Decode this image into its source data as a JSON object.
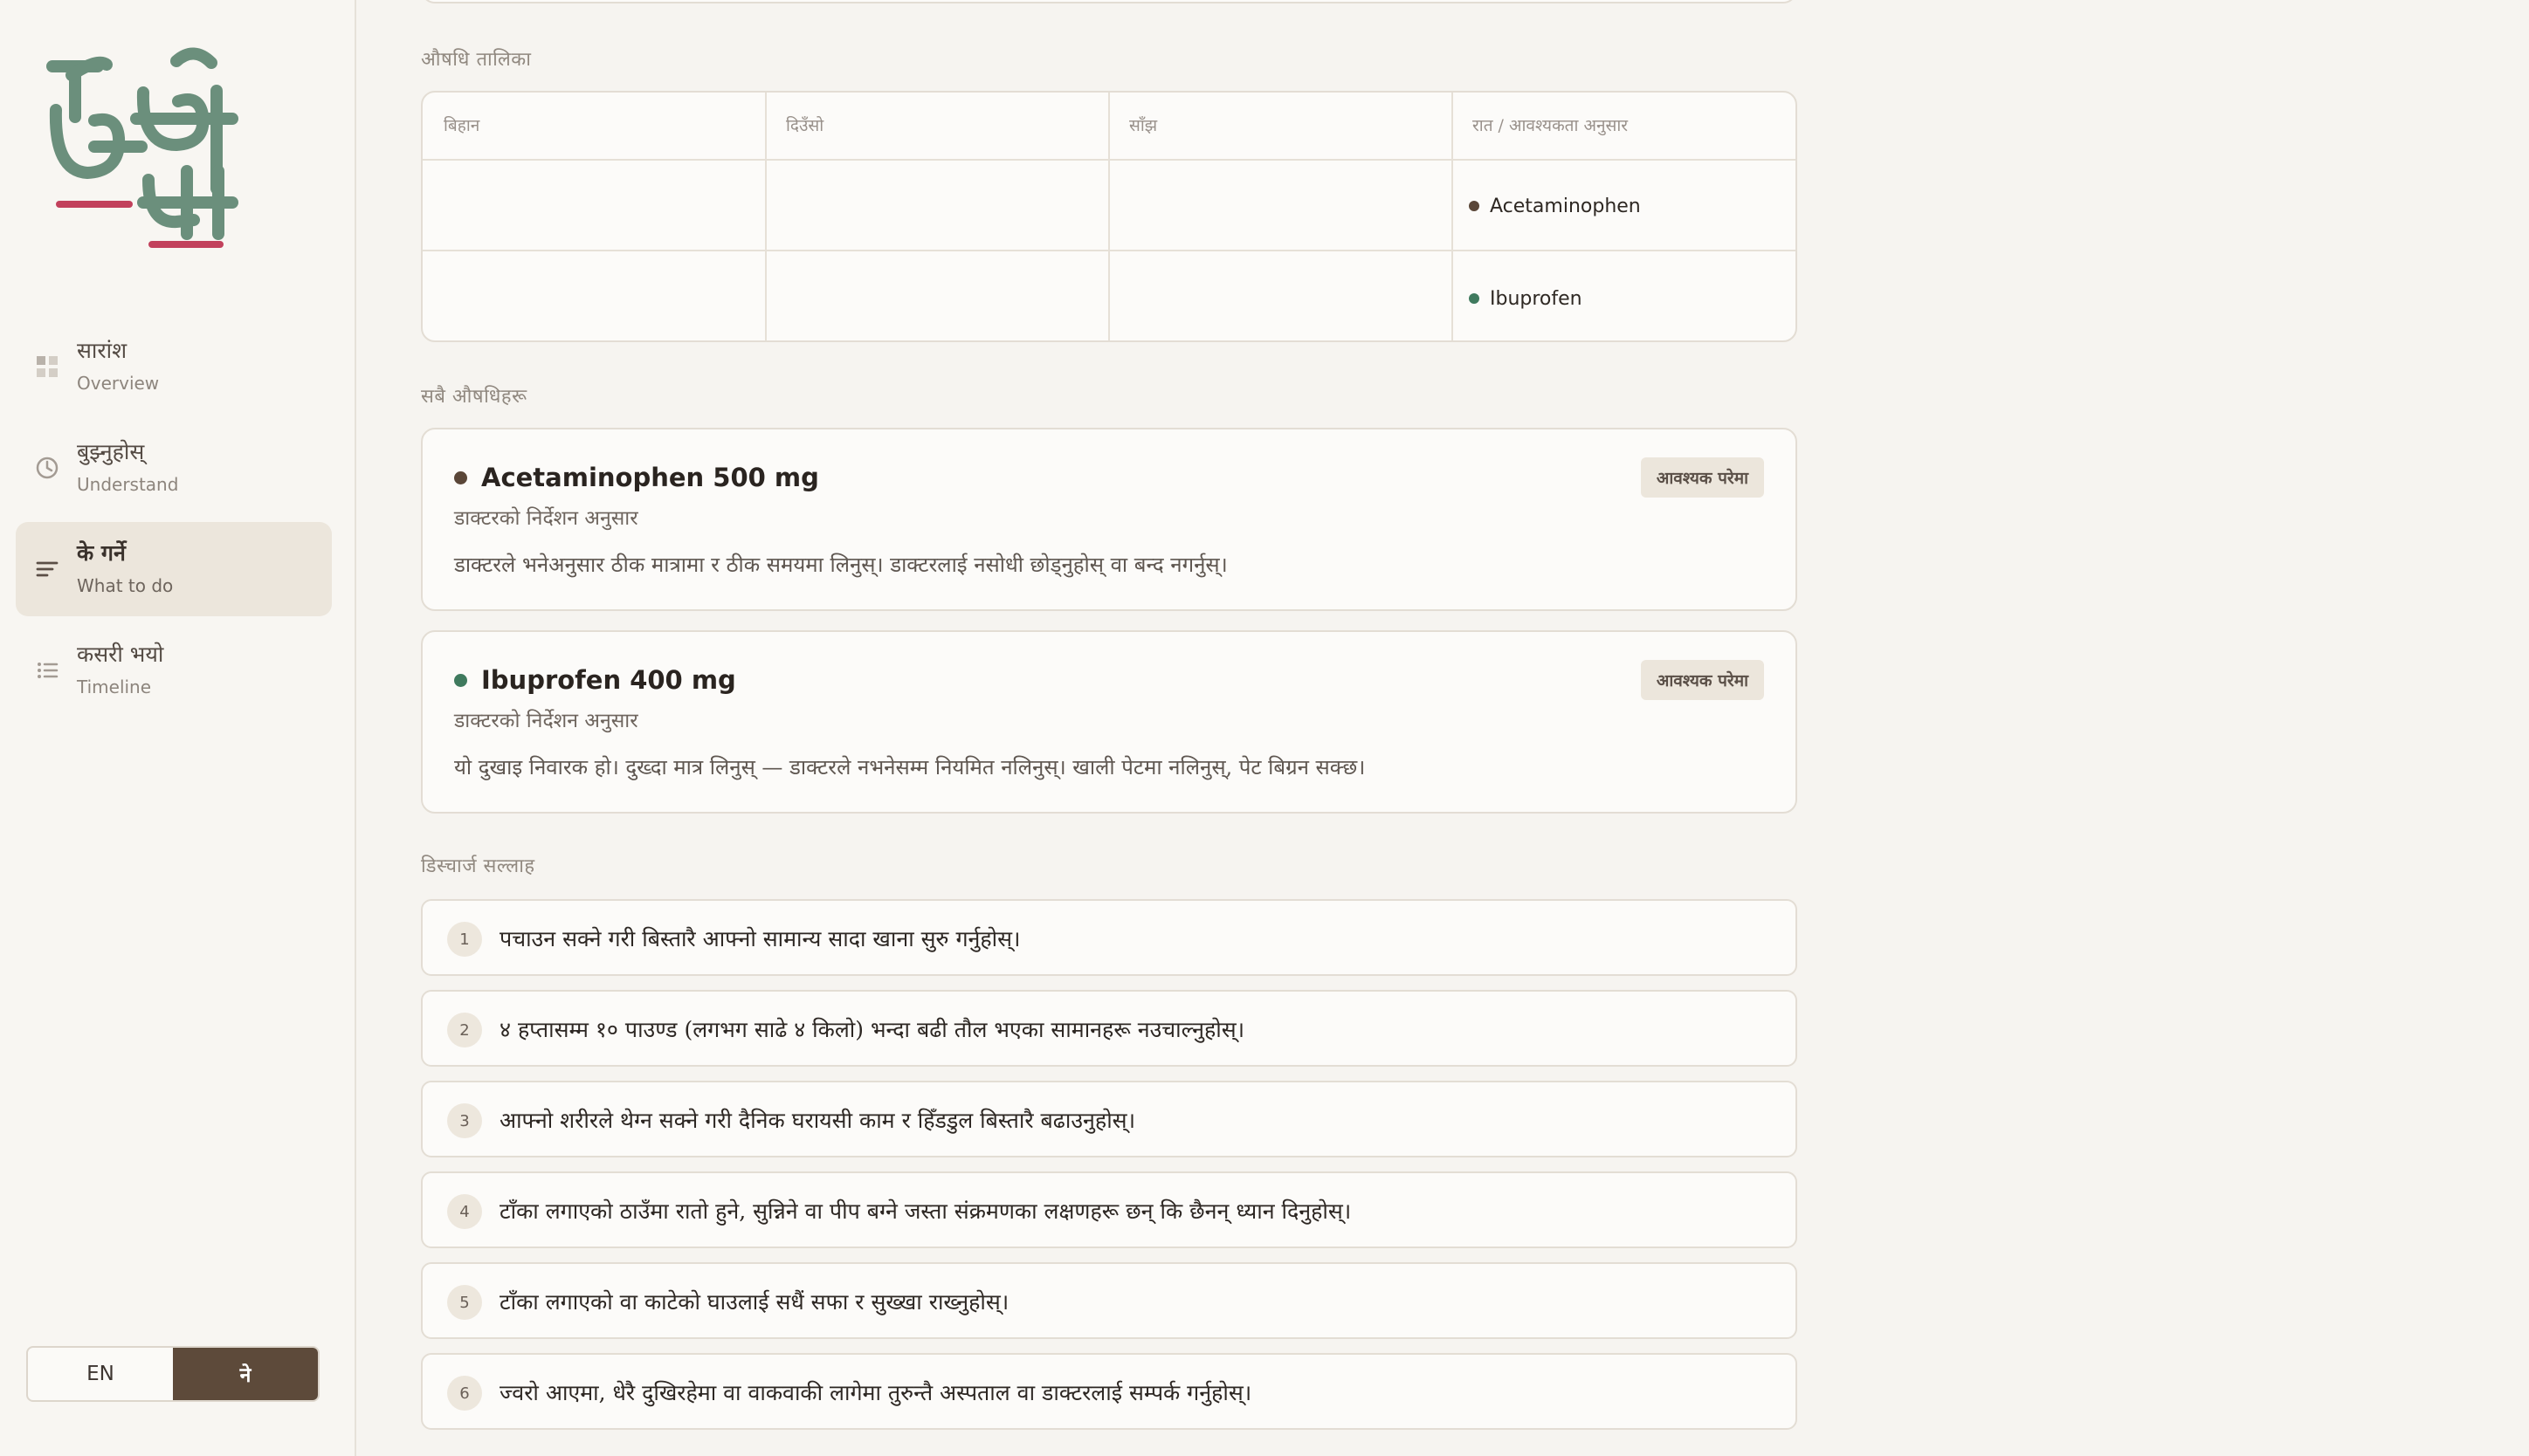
{
  "colors": {
    "brand_green": "#6b8f7c",
    "brand_red": "#c2415c",
    "accent_brown": "#5d4a3a",
    "acetaminophen_dot": "#5a4638",
    "ibuprofen_dot": "#3f7a5e"
  },
  "logo": {
    "text": "केभो या"
  },
  "sidebar": {
    "items": [
      {
        "label_ne": "सारांश",
        "label_en": "Overview",
        "icon": "grid-icon",
        "active": false
      },
      {
        "label_ne": "बुझ्नुहोस्",
        "label_en": "Understand",
        "icon": "clock-icon",
        "active": false
      },
      {
        "label_ne": "के गर्ने",
        "label_en": "What to do",
        "icon": "lines-icon",
        "active": true
      },
      {
        "label_ne": "कसरी भयो",
        "label_en": "Timeline",
        "icon": "list-icon",
        "active": false
      }
    ],
    "language": {
      "en": "EN",
      "ne": "ने",
      "selected": "ne"
    }
  },
  "schedule": {
    "section_label": "औषधि तालिका",
    "columns": [
      "बिहान",
      "दिउँसो",
      "साँझ",
      "रात / आवश्यकता अनुसार"
    ],
    "rows": [
      [
        "",
        "",
        "",
        "Acetaminophen"
      ],
      [
        "",
        "",
        "",
        "Ibuprofen"
      ]
    ]
  },
  "medications": {
    "section_label": "सबै औषधिहरू",
    "items": [
      {
        "name": "Acetaminophen 500 mg",
        "dosage": "डाक्टरको निर्देशन अनुसार",
        "badge": "आवश्यक परेमा",
        "description": "डाक्टरले भनेअनुसार ठीक मात्रामा र ठीक समयमा लिनुस्। डाक्टरलाई नसोधी छोड्नुहोस् वा बन्द नगर्नुस्।"
      },
      {
        "name": "Ibuprofen 400 mg",
        "dosage": "डाक्टरको निर्देशन अनुसार",
        "badge": "आवश्यक परेमा",
        "description": "यो दुखाइ निवारक हो। दुख्दा मात्र लिनुस् — डाक्टरले नभनेसम्म नियमित नलिनुस्। खाली पेटमा नलिनुस्, पेट बिग्रन सक्छ।"
      }
    ]
  },
  "discharge_advice": {
    "section_label": "डिस्चार्ज सल्लाह",
    "items": [
      {
        "num": "1",
        "text": "पचाउन सक्ने गरी बिस्तारै आफ्नो सामान्य सादा खाना सुरु गर्नुहोस्।"
      },
      {
        "num": "2",
        "text": "४ हप्तासम्म १० पाउण्ड (लगभग साढे ४ किलो) भन्दा बढी तौल भएका सामानहरू नउचाल्नुहोस्।"
      },
      {
        "num": "3",
        "text": "आफ्नो शरीरले थेग्न सक्ने गरी दैनिक घरायसी काम र हिँडडुल बिस्तारै बढाउनुहोस्।"
      },
      {
        "num": "4",
        "text": "टाँका लगाएको ठाउँमा रातो हुने, सुन्निने वा पीप बग्ने जस्ता संक्रमणका लक्षणहरू छन् कि छैनन् ध्यान दिनुहोस्।"
      },
      {
        "num": "5",
        "text": "टाँका लगाएको वा काटेको घाउलाई सधैं सफा र सुख्खा राख्नुहोस्।"
      },
      {
        "num": "6",
        "text": "ज्वरो आएमा, धेरै दुखिरहेमा वा वाकवाकी लागेमा तुरुन्तै अस्पताल वा डाक्टरलाई सम्पर्क गर्नुहोस्।"
      }
    ]
  }
}
